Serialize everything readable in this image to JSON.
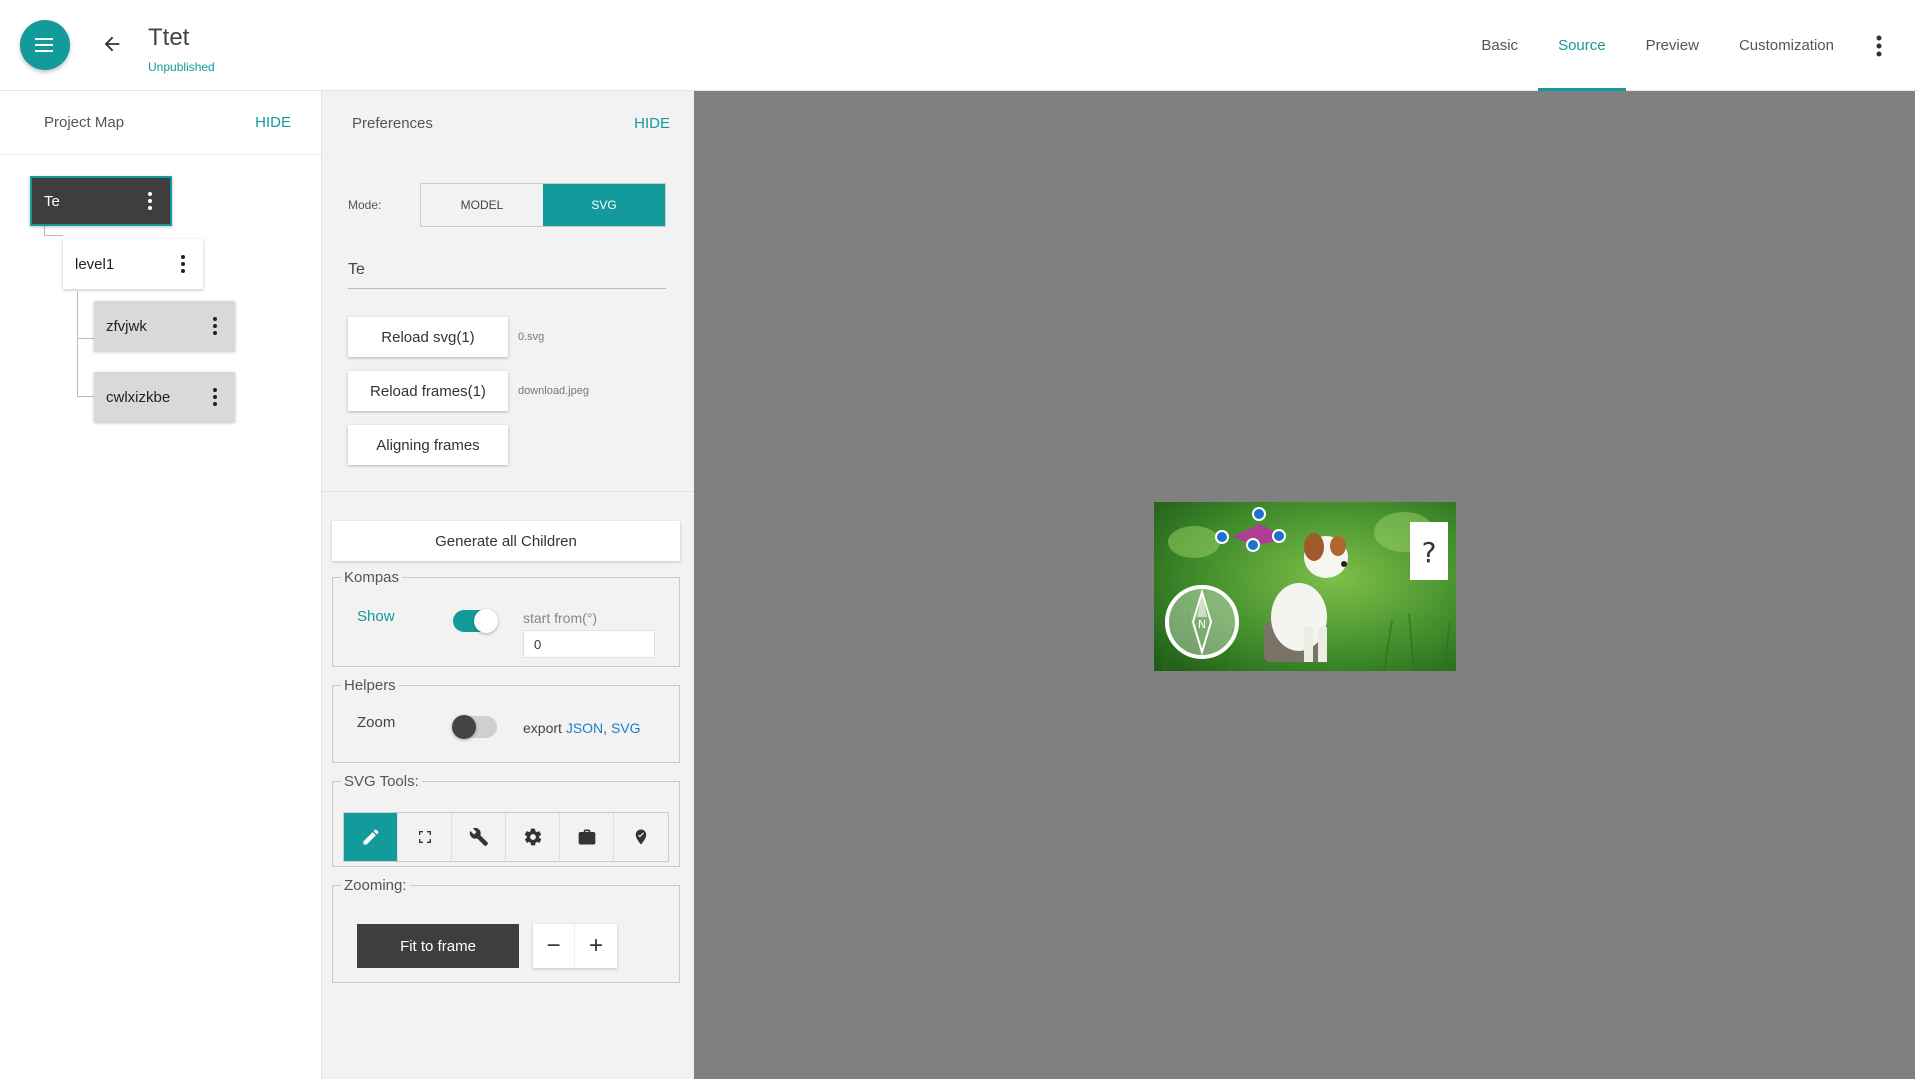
{
  "header": {
    "title": "Ttet",
    "status": "Unpublished",
    "tabs": [
      {
        "label": "Basic",
        "active": false
      },
      {
        "label": "Source",
        "active": true
      },
      {
        "label": "Preview",
        "active": false
      },
      {
        "label": "Customization",
        "active": false
      }
    ],
    "icons": {
      "menu": "menu-icon",
      "back": "arrow-back-icon",
      "more": "more-vert-icon"
    }
  },
  "project_map": {
    "title": "Project Map",
    "hide_label": "HIDE",
    "tree": {
      "root": "Te",
      "level1": "level1",
      "children": [
        "zfvjwk",
        "cwlxizkbe"
      ]
    }
  },
  "preferences": {
    "title": "Preferences",
    "hide_label": "HIDE",
    "mode_label": "Mode:",
    "modes": [
      "MODEL",
      "SVG"
    ],
    "active_mode": "SVG",
    "name_value": "Te",
    "reload_svg_label": "Reload svg(1)",
    "reload_svg_file": "0.svg",
    "reload_frames_label": "Reload frames(1)",
    "reload_frames_file": "download.jpeg",
    "aligning_label": "Aligning frames",
    "generate_label": "Generate all Children",
    "kompas": {
      "legend": "Kompas",
      "show_label": "Show",
      "show_on": true,
      "start_label": "start from(°)",
      "start_value": "0"
    },
    "helpers": {
      "legend": "Helpers",
      "zoom_label": "Zoom",
      "zoom_on": false,
      "export_label": "export",
      "export_json": "JSON",
      "export_sep": ",",
      "export_svg": "SVG"
    },
    "svg_tools": {
      "legend": "SVG Tools:",
      "tools": [
        "pencil-icon",
        "fullscreen-icon",
        "wrench-icon",
        "gear-icon",
        "briefcase-icon",
        "map-marker-icon"
      ],
      "active_tool": "pencil-icon"
    },
    "zooming": {
      "legend": "Zooming:",
      "fit_label": "Fit to frame",
      "minus_label": "−",
      "plus_label": "+"
    }
  },
  "canvas": {
    "help_label": "?",
    "compass_letter": "N",
    "colors": {
      "background": "#808080",
      "polygon": "#c02ea5",
      "handle": "#1e73c8",
      "accent": "#139a9a"
    }
  }
}
